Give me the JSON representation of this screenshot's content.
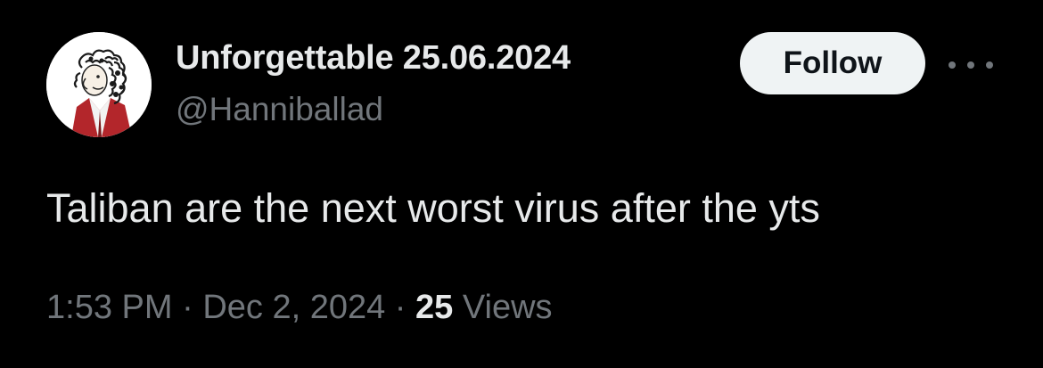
{
  "author": {
    "display_name": "Unforgettable 25.06.2024",
    "handle": "@Hanniballad",
    "avatar_icon": "caricature-avatar-icon"
  },
  "actions": {
    "follow_label": "Follow",
    "more_icon": "more-options-icon"
  },
  "tweet": {
    "text": "Taliban are the next worst virus after the yts"
  },
  "meta": {
    "time": "1:53 PM",
    "separator": "·",
    "date": "Dec 2, 2024",
    "views_count": "25",
    "views_label": "Views"
  },
  "colors": {
    "background": "#000000",
    "primary_text": "#e7e9ea",
    "secondary_text": "#71767b",
    "follow_button_bg": "#eff3f4",
    "follow_button_text": "#0f1419"
  }
}
